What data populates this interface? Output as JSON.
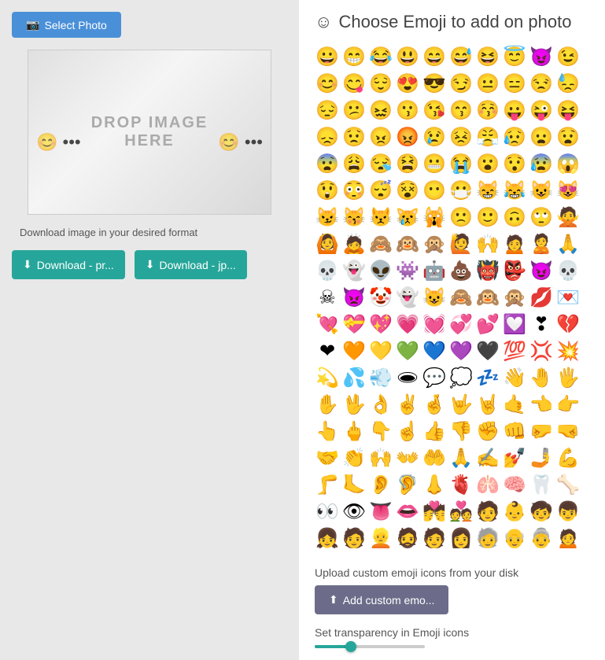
{
  "leftPanel": {
    "selectPhotoLabel": "Select Photo",
    "dropText": "DROP IMAGE\nHERE",
    "downloadInfo": "Download image in your desired format",
    "downloadPngLabel": "Download - pr...",
    "downloadJpgLabel": "Download - jp...",
    "overlayEmoji": "😊"
  },
  "rightPanel": {
    "title": "Choose Emoji to add on photo",
    "titleIcon": "☺",
    "emojis": [
      "😀",
      "😁",
      "😂",
      "😃",
      "😄",
      "😅",
      "😆",
      "😇",
      "😈",
      "😉",
      "😊",
      "😋",
      "😌",
      "😍",
      "😎",
      "😏",
      "😐",
      "😑",
      "😒",
      "😓",
      "😔",
      "😕",
      "😖",
      "😗",
      "😘",
      "😙",
      "😚",
      "😛",
      "😜",
      "😝",
      "😞",
      "😟",
      "😠",
      "😡",
      "😢",
      "😣",
      "😤",
      "😥",
      "😦",
      "😧",
      "😨",
      "😩",
      "😪",
      "😫",
      "😬",
      "😭",
      "😮",
      "😯",
      "😰",
      "😱",
      "😲",
      "😳",
      "😴",
      "😵",
      "😶",
      "😷",
      "😸",
      "😹",
      "😺",
      "😻",
      "😼",
      "😽",
      "😾",
      "😿",
      "🙀",
      "🙁",
      "🙂",
      "🙃",
      "🙄",
      "🙅",
      "🙆",
      "🙇",
      "🙈",
      "🙉",
      "🙊",
      "🙋",
      "🙌",
      "🙍",
      "🙎",
      "🙏",
      "💀",
      "👻",
      "👽",
      "👾",
      "🤖",
      "💩",
      "👹",
      "👺",
      "😈",
      "💀",
      "☠",
      "👿",
      "🤡",
      "👻",
      "😺",
      "🙈",
      "🙉",
      "🙊",
      "💋",
      "💌",
      "💘",
      "💝",
      "💖",
      "💗",
      "💓",
      "💞",
      "💕",
      "💟",
      "❣",
      "💔",
      "❤",
      "🧡",
      "💛",
      "💚",
      "💙",
      "💜",
      "🖤",
      "💯",
      "💢",
      "💥",
      "💫",
      "💦",
      "💨",
      "🕳",
      "💬",
      "💭",
      "💤",
      "👋",
      "🤚",
      "🖐",
      "✋",
      "🖖",
      "👌",
      "✌",
      "🤞",
      "🤟",
      "🤘",
      "🤙",
      "👈",
      "👉",
      "👆",
      "🖕",
      "👇",
      "☝",
      "👍",
      "👎",
      "✊",
      "👊",
      "🤛",
      "🤜",
      "🤝",
      "👏",
      "🙌",
      "👐",
      "🤲",
      "🙏",
      "✍",
      "💅",
      "🤳",
      "💪",
      "🦵",
      "🦶",
      "👂",
      "🦻",
      "👃",
      "🫀",
      "🫁",
      "🧠",
      "🦷",
      "🦴",
      "👀",
      "👁",
      "👅",
      "👄",
      "💏",
      "💑",
      "🧑",
      "👶",
      "🧒",
      "👦",
      "👧",
      "🧑",
      "👱",
      "🧔",
      "🧑",
      "👩",
      "🧓",
      "👴",
      "👵",
      "🙍"
    ],
    "uploadLabel": "Upload custom emoji icons from your disk",
    "addCustomLabel": "Add custom emo...",
    "transparencyLabel": "Set transparency in Emoji icons",
    "sliderValue": 30
  }
}
